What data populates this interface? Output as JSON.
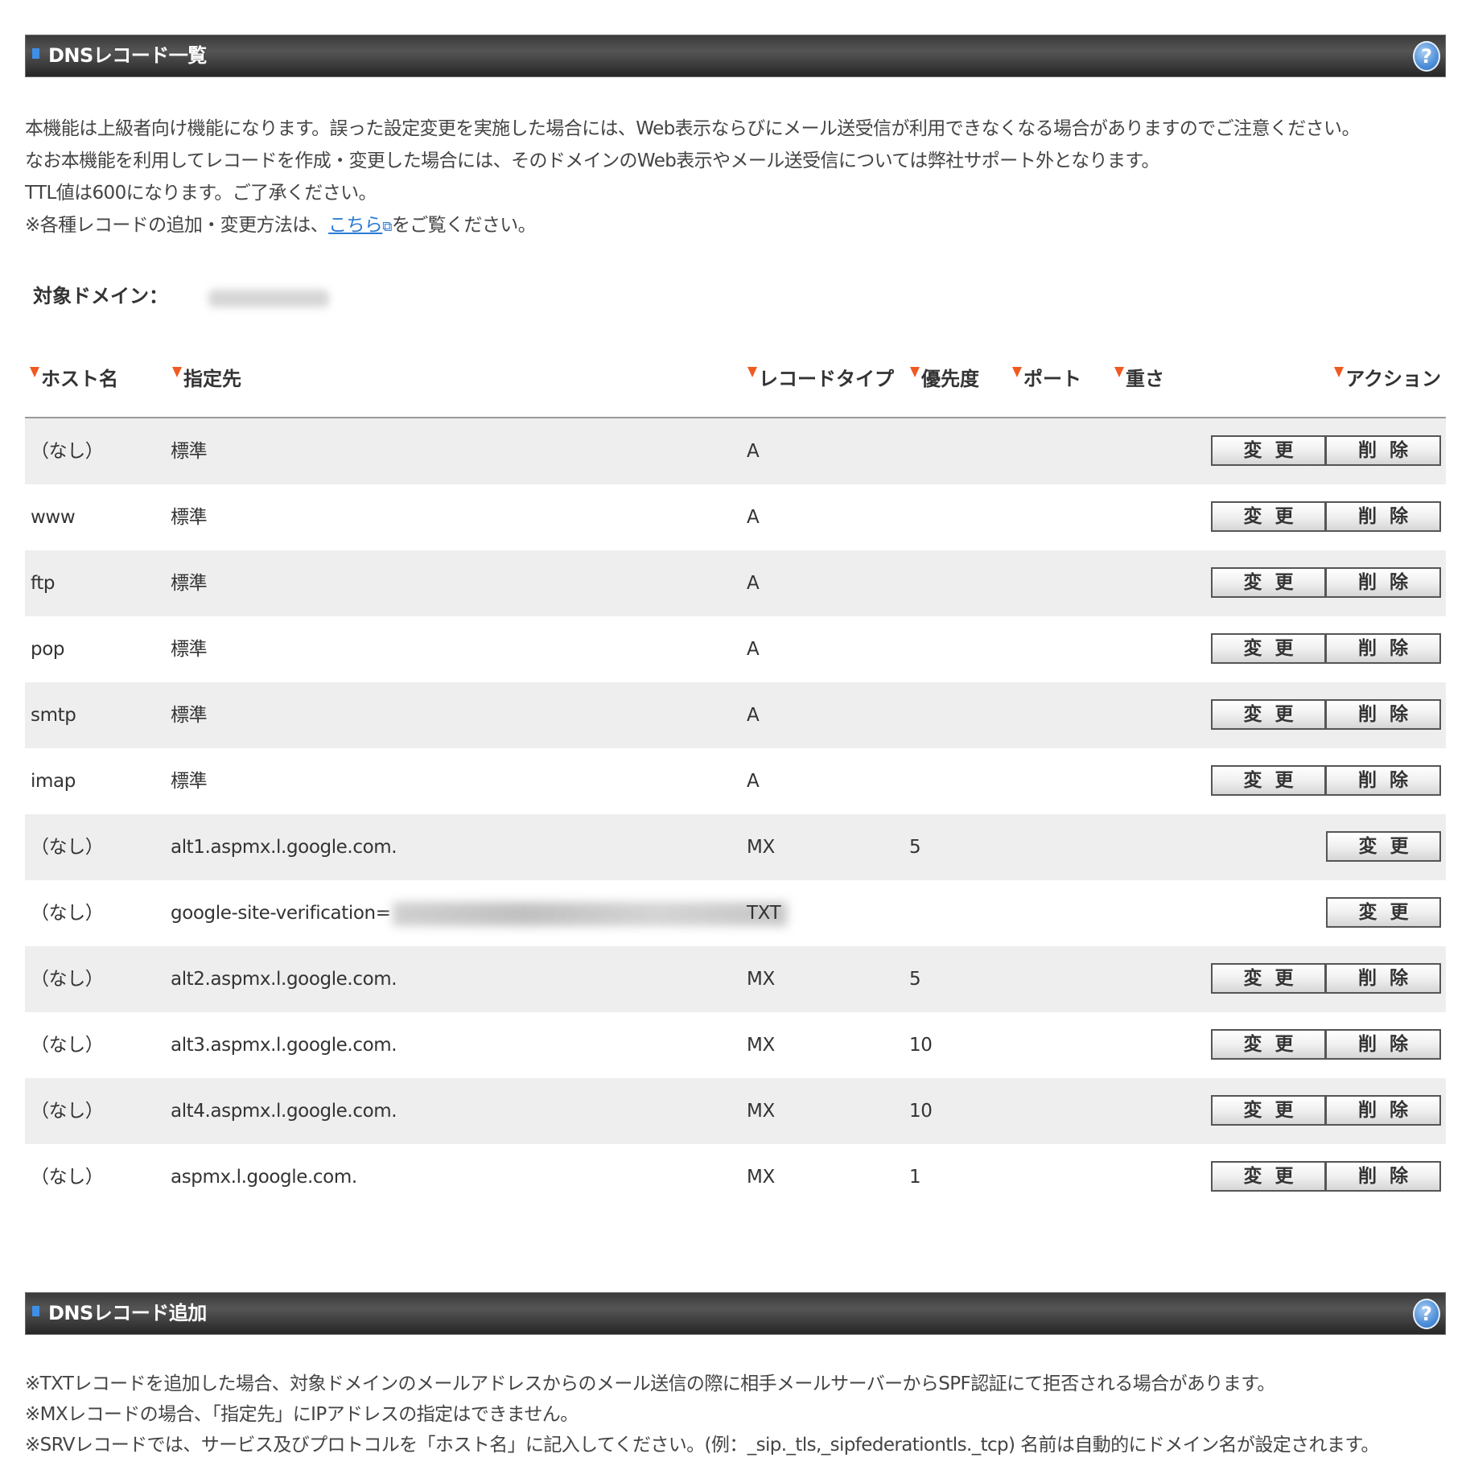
{
  "list_section": {
    "title": "DNSレコード一覧",
    "help_icon": "?"
  },
  "description": {
    "line1": "本機能は上級者向け機能になります。誤った設定変更を実施した場合には、Web表示ならびにメール送受信が利用できなくなる場合がありますのでご注意ください。",
    "line2": "なお本機能を利用してレコードを作成・変更した場合には、そのドメインのWeb表示やメール送受信については弊社サポート外となります。",
    "line3": "TTL値は600になります。ご了承ください。",
    "line4_prefix": "※各種レコードの追加・変更方法は、",
    "line4_link": "こちら",
    "line4_link_icon": "external-link-icon",
    "line4_suffix": "をご覧ください。"
  },
  "domain": {
    "label": "対象ドメイン："
  },
  "table": {
    "headers": {
      "host": "ホスト名",
      "target": "指定先",
      "type": "レコードタイプ",
      "priority": "優先度",
      "port": "ポート",
      "weight": "重さ",
      "action": "アクション"
    },
    "buttons": {
      "edit": "変更",
      "delete": "削除"
    },
    "rows": [
      {
        "host": "（なし）",
        "target": "標準",
        "type": "A",
        "priority": ""
      },
      {
        "host": "www",
        "target": "標準",
        "type": "A",
        "priority": ""
      },
      {
        "host": "ftp",
        "target": "標準",
        "type": "A",
        "priority": ""
      },
      {
        "host": "pop",
        "target": "標準",
        "type": "A",
        "priority": ""
      },
      {
        "host": "smtp",
        "target": "標準",
        "type": "A",
        "priority": ""
      },
      {
        "host": "imap",
        "target": "標準",
        "type": "A",
        "priority": ""
      },
      {
        "host": "（なし）",
        "target": "alt1.aspmx.l.google.com.",
        "type": "MX",
        "priority": "5"
      },
      {
        "host": "（なし）",
        "target": "google-site-verification=",
        "type": "TXT",
        "priority": ""
      },
      {
        "host": "（なし）",
        "target": "alt2.aspmx.l.google.com.",
        "type": "MX",
        "priority": "5"
      },
      {
        "host": "（なし）",
        "target": "alt3.aspmx.l.google.com.",
        "type": "MX",
        "priority": "10"
      },
      {
        "host": "（なし）",
        "target": "alt4.aspmx.l.google.com.",
        "type": "MX",
        "priority": "10"
      },
      {
        "host": "（なし）",
        "target": "aspmx.l.google.com.",
        "type": "MX",
        "priority": "1"
      }
    ]
  },
  "add_section": {
    "title": "DNSレコード追加",
    "help_icon": "?"
  },
  "notes": {
    "line1": "※TXTレコードを追加した場合、対象ドメインのメールアドレスからのメール送信の際に相手メールサーバーからSPF認証にて拒否される場合があります。",
    "line2": "※MXレコードの場合、「指定先」にIPアドレスの指定はできません。",
    "line3": "※SRVレコードでは、サービス及びプロトコルを「ホスト名」に記入してください。(例：_sip._tls,_sipfederationtls._tcp) 名前は自動的にドメイン名が設定されます。"
  },
  "colors": {
    "accent_triangle": "#f05a22",
    "header_bullet": "#3d8fe8",
    "link": "#2a7ad5",
    "row_stripe": "#eeeeee"
  }
}
